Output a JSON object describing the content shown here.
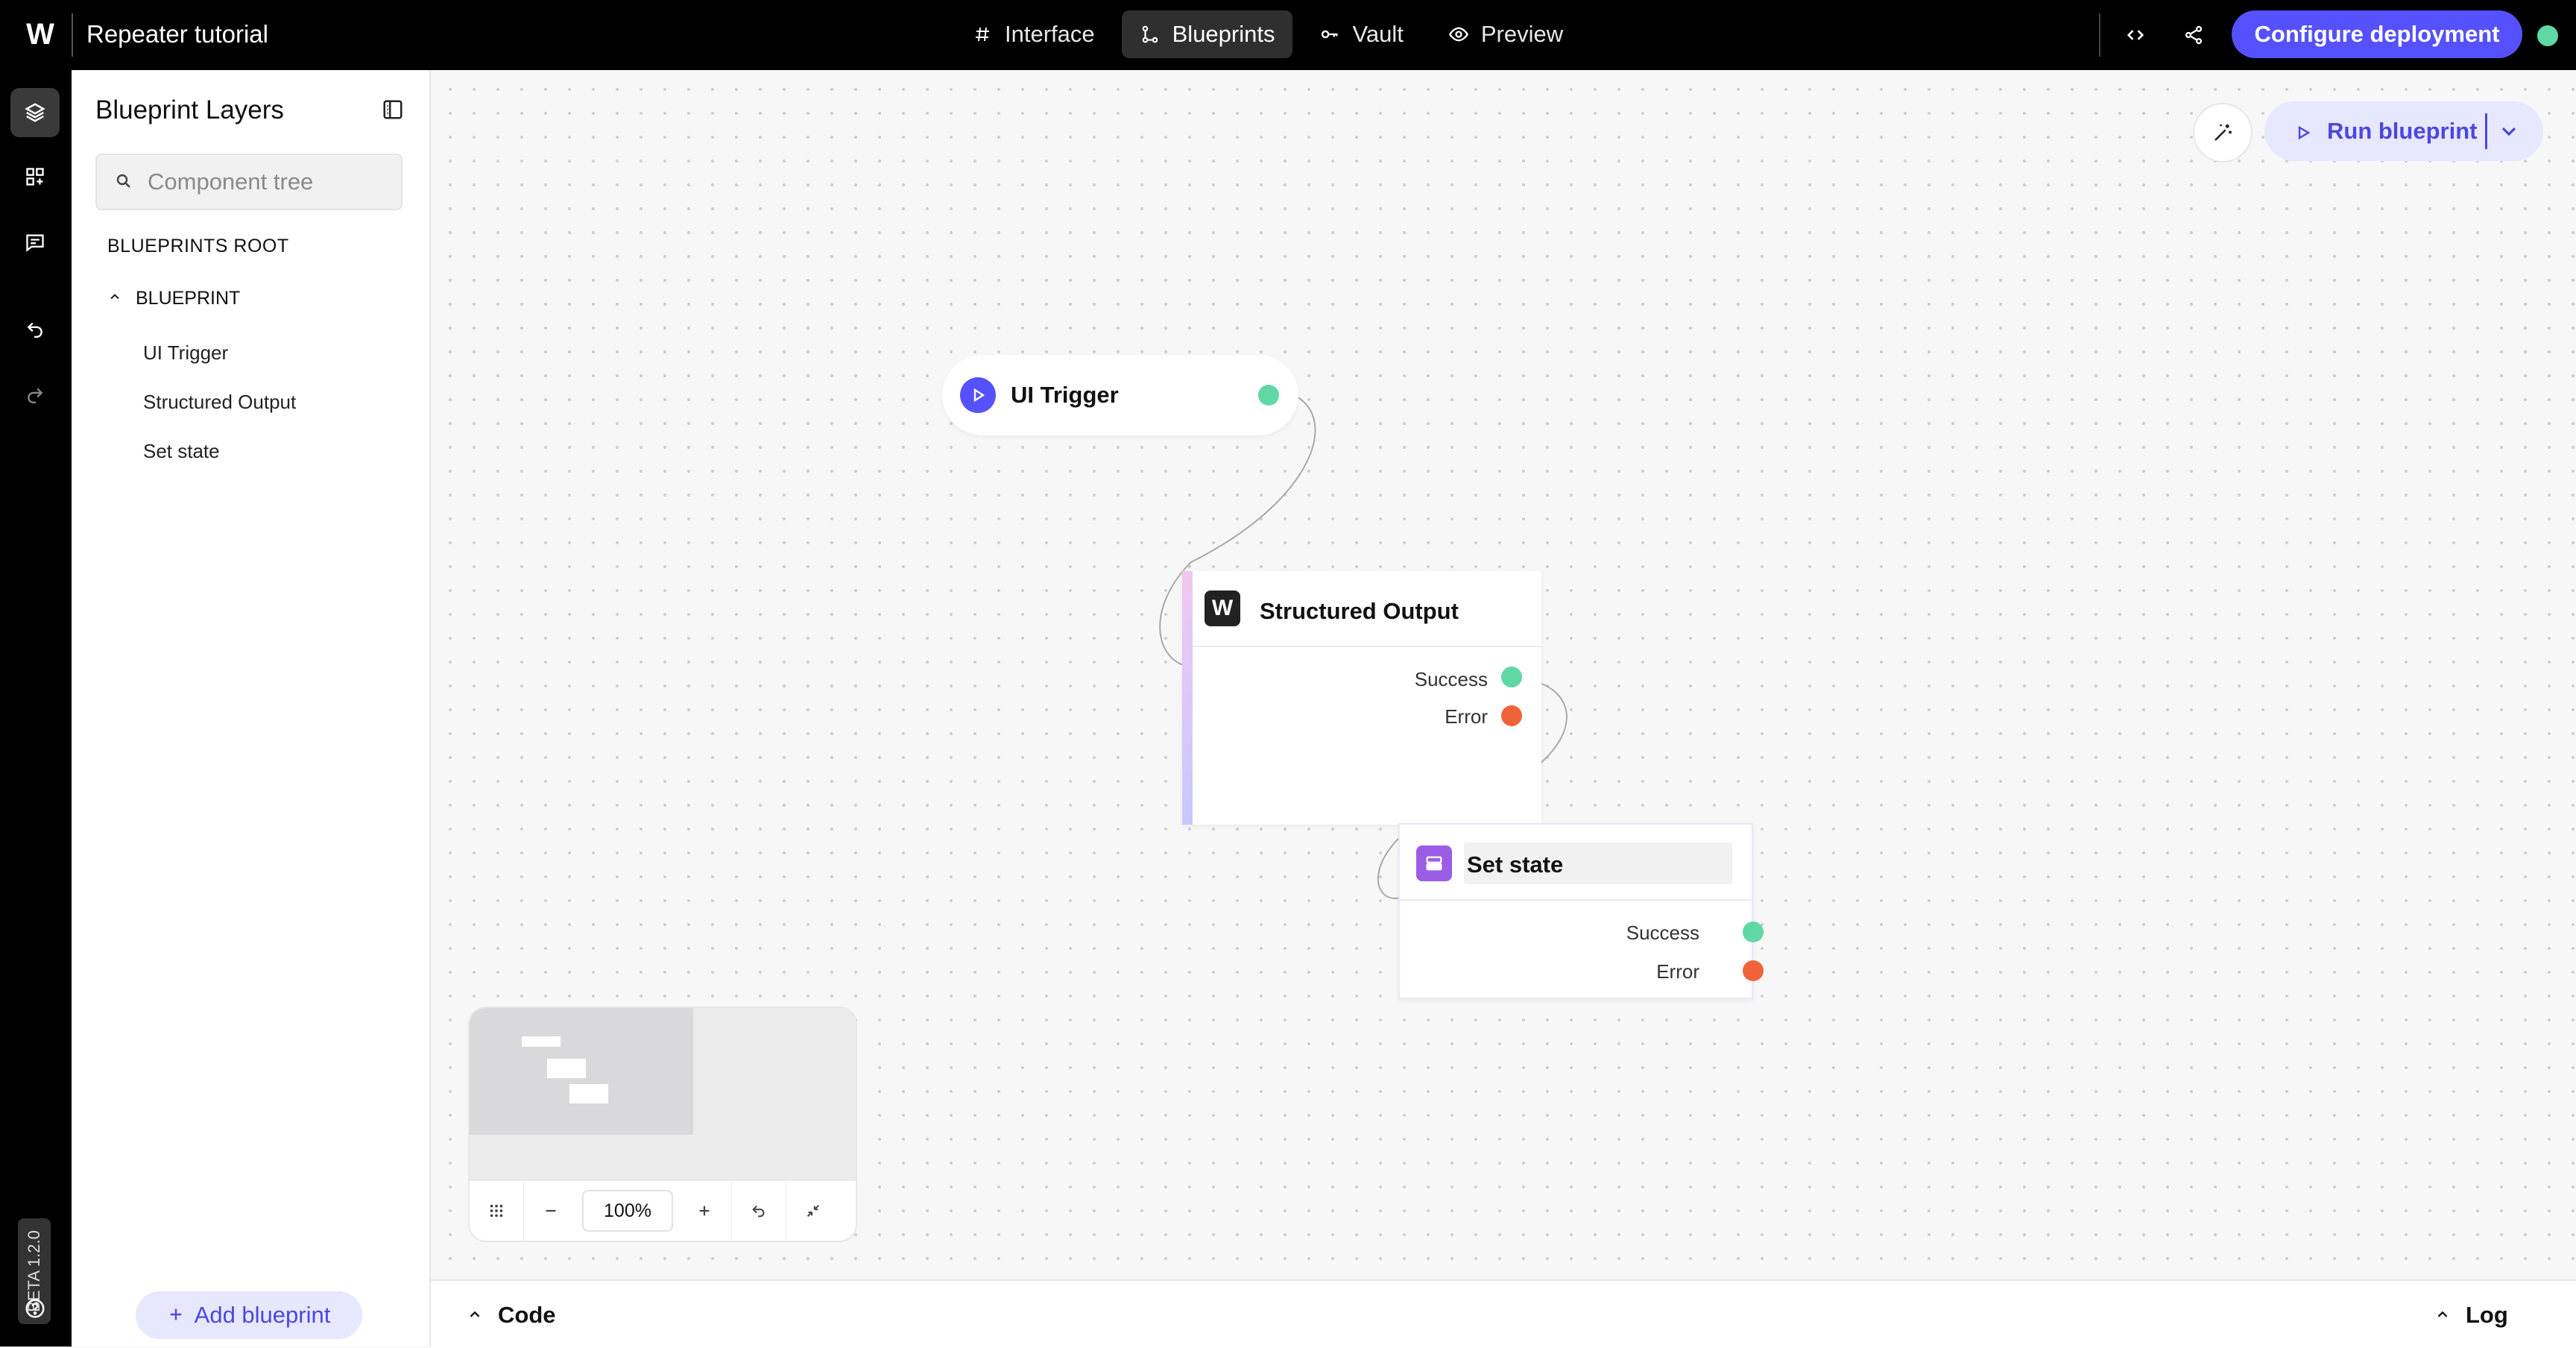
{
  "app": {
    "title": "Repeater tutorial"
  },
  "topnav": {
    "items": [
      {
        "label": "Interface",
        "icon": "hash-icon"
      },
      {
        "label": "Blueprints",
        "icon": "blueprints-icon",
        "active": true
      },
      {
        "label": "Vault",
        "icon": "key-icon"
      },
      {
        "label": "Preview",
        "icon": "eye-icon"
      }
    ],
    "deploy_label": "Configure deployment"
  },
  "rail": {
    "version": "BETA 1.2.0"
  },
  "layers": {
    "title": "Blueprint Layers",
    "search_placeholder": "Component tree",
    "root_label": "BLUEPRINTS ROOT",
    "blueprint_label": "BLUEPRINT",
    "items": [
      "UI Trigger",
      "Structured Output",
      "Set state"
    ],
    "add_label": "Add blueprint"
  },
  "canvas": {
    "run_label": "Run blueprint",
    "nodes": {
      "trigger": {
        "title": "UI Trigger"
      },
      "structured": {
        "title": "Structured Output",
        "success": "Success",
        "error": "Error"
      },
      "setstate": {
        "title": "Set state",
        "success": "Success",
        "error": "Error"
      }
    },
    "zoom": "100%"
  },
  "bottom": {
    "code_label": "Code",
    "log_label": "Log"
  },
  "colors": {
    "accent": "#5551ff",
    "accent_light": "#e7e7ff",
    "success": "#5fd8a3",
    "error": "#f0633a"
  }
}
